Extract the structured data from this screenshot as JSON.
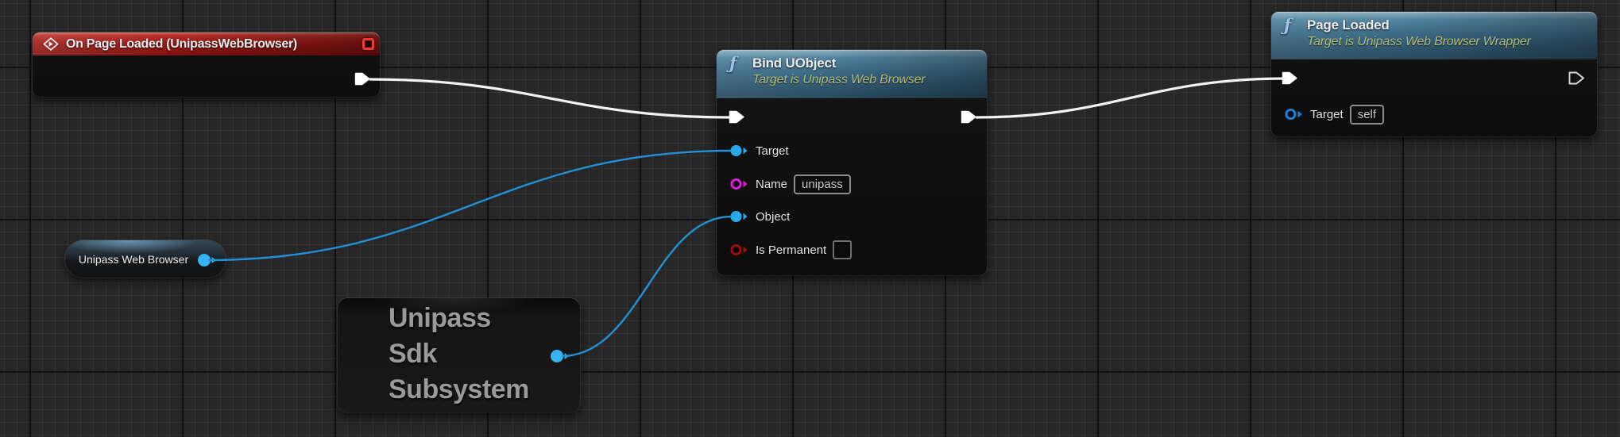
{
  "graph": {
    "background_color": "#272727",
    "exec_wire_color": "#f2f2f2",
    "data_wire_color": "#2292d8"
  },
  "nodes": {
    "on_page_loaded": {
      "type": "event",
      "title": "On Page Loaded (UnipassWebBrowser)",
      "header_color": "#9a1814"
    },
    "bind_uobject": {
      "type": "function",
      "title": "Bind UObject",
      "subtitle": "Target is Unipass Web Browser",
      "header_color": "#3c6b87",
      "pins": [
        {
          "label": "Target",
          "color": "#2aa9e8",
          "connected": true
        },
        {
          "label": "Name",
          "color": "#dc1ddc",
          "connected": false,
          "value": "unipass"
        },
        {
          "label": "Object",
          "color": "#2aa9e8",
          "connected": true
        },
        {
          "label": "Is Permanent",
          "color": "#9e0e0e",
          "connected": false,
          "checked": false
        }
      ]
    },
    "page_loaded": {
      "type": "function",
      "title": "Page Loaded",
      "subtitle": "Target is Unipass Web Browser Wrapper",
      "header_color": "#3c6b87",
      "pins": [
        {
          "label": "Target",
          "color": "#1f82d0",
          "connected": false,
          "value": "self"
        }
      ]
    },
    "unipass_web_browser": {
      "type": "variable-get",
      "title": "Unipass Web Browser",
      "pin_color": "#36b5f4"
    },
    "unipass_sdk_subsystem": {
      "type": "subsystem-get",
      "title_lines": {
        "0": "Unipass",
        "1": "Sdk",
        "2": "Subsystem"
      },
      "pin_color": "#36b5f4"
    }
  }
}
